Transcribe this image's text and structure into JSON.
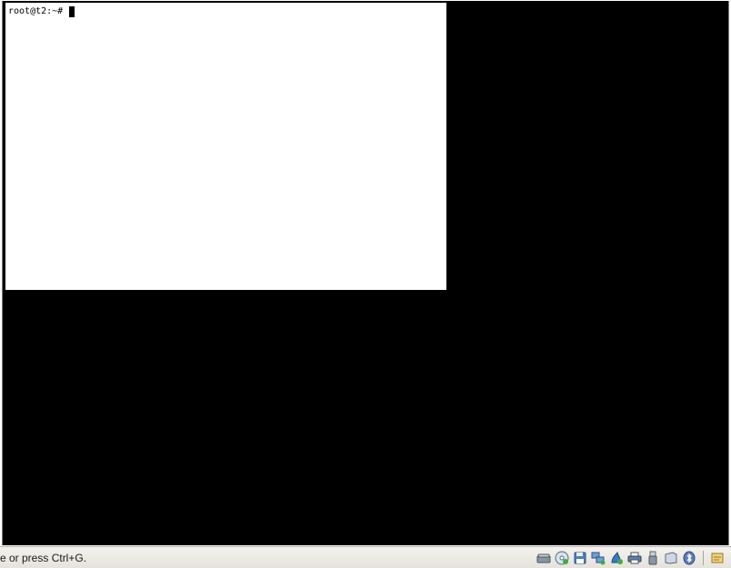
{
  "terminal": {
    "prompt": "root@t2:~#"
  },
  "status_bar": {
    "message": "e or press Ctrl+G."
  },
  "status_icons": [
    "hard-disk-icon",
    "optical-drive-icon",
    "floppy-icon",
    "network-icon",
    "shared-folders-icon",
    "printer-icon",
    "usb-icon",
    "display-icon",
    "bluetooth-icon",
    "host-key-icon"
  ],
  "colors": {
    "vm_background": "#000000",
    "terminal_background": "#ffffff",
    "status_bar": "#eceae4"
  }
}
